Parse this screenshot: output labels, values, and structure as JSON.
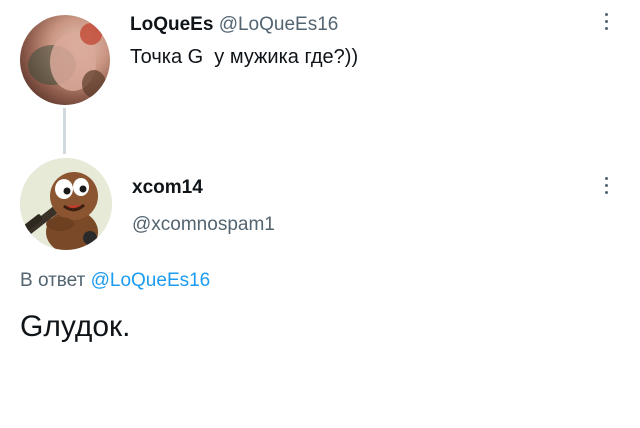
{
  "tweet1": {
    "display_name": "LoQueEs",
    "handle": "@LoQueEs16",
    "text": "Точка G  у мужика где?))"
  },
  "tweet2": {
    "display_name": "xcom14",
    "handle": "@xcomnospam1",
    "reply_prefix": "В ответ ",
    "reply_to": "@LoQueEs16",
    "text": "Gлудок."
  },
  "icons": {
    "more": "more-vertical-icon"
  },
  "colors": {
    "text_primary": "#0f1419",
    "text_secondary": "#536471",
    "mention": "#1d9bf0",
    "thread_line": "#cfd9de"
  }
}
